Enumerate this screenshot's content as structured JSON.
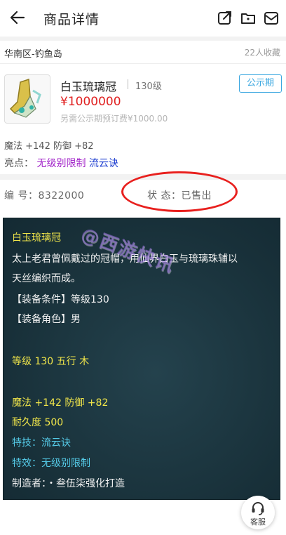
{
  "header": {
    "title": "商品详情",
    "icons": [
      "share-icon",
      "folder-icon",
      "mail-icon"
    ]
  },
  "server": {
    "region": "华南区-钓鱼岛",
    "favorites": "22人收藏"
  },
  "item": {
    "name": "白玉琉璃冠",
    "level": "130级",
    "badge": "公示期",
    "price": "¥1000000",
    "fee": "另需公示期预订费¥1000.00",
    "attrs": "魔法 +142 防御 +82",
    "highlight_label": "亮点：",
    "highlight_1": "无级别限制",
    "highlight_2": "流云诀"
  },
  "meta": {
    "serial": "编  号：8322000",
    "status": "状  态：已售出"
  },
  "detail": {
    "name": "白玉琉璃冠",
    "desc_line1": "太上老君曾佩戴过的冠帽，用仙界白玉与琉璃珠辅以",
    "desc_line2": "天丝编织而成。",
    "req_level": "【装备条件】等级130",
    "req_role": "【装备角色】男",
    "level_element": "等级 130 五行 木",
    "stats": "魔法 +142 防御 +82",
    "durability": "耐久度 500",
    "skill": "特技：流云诀",
    "effect": "特效：无级别限制",
    "maker": "制造者：・叁伍柒强化打造"
  },
  "watermark": "@西游快讯",
  "service": {
    "label": "客服"
  },
  "colors": {
    "price": "#e02020",
    "badge": "#3aa7e0",
    "panel": "#183039",
    "circle": "#e8201e"
  }
}
